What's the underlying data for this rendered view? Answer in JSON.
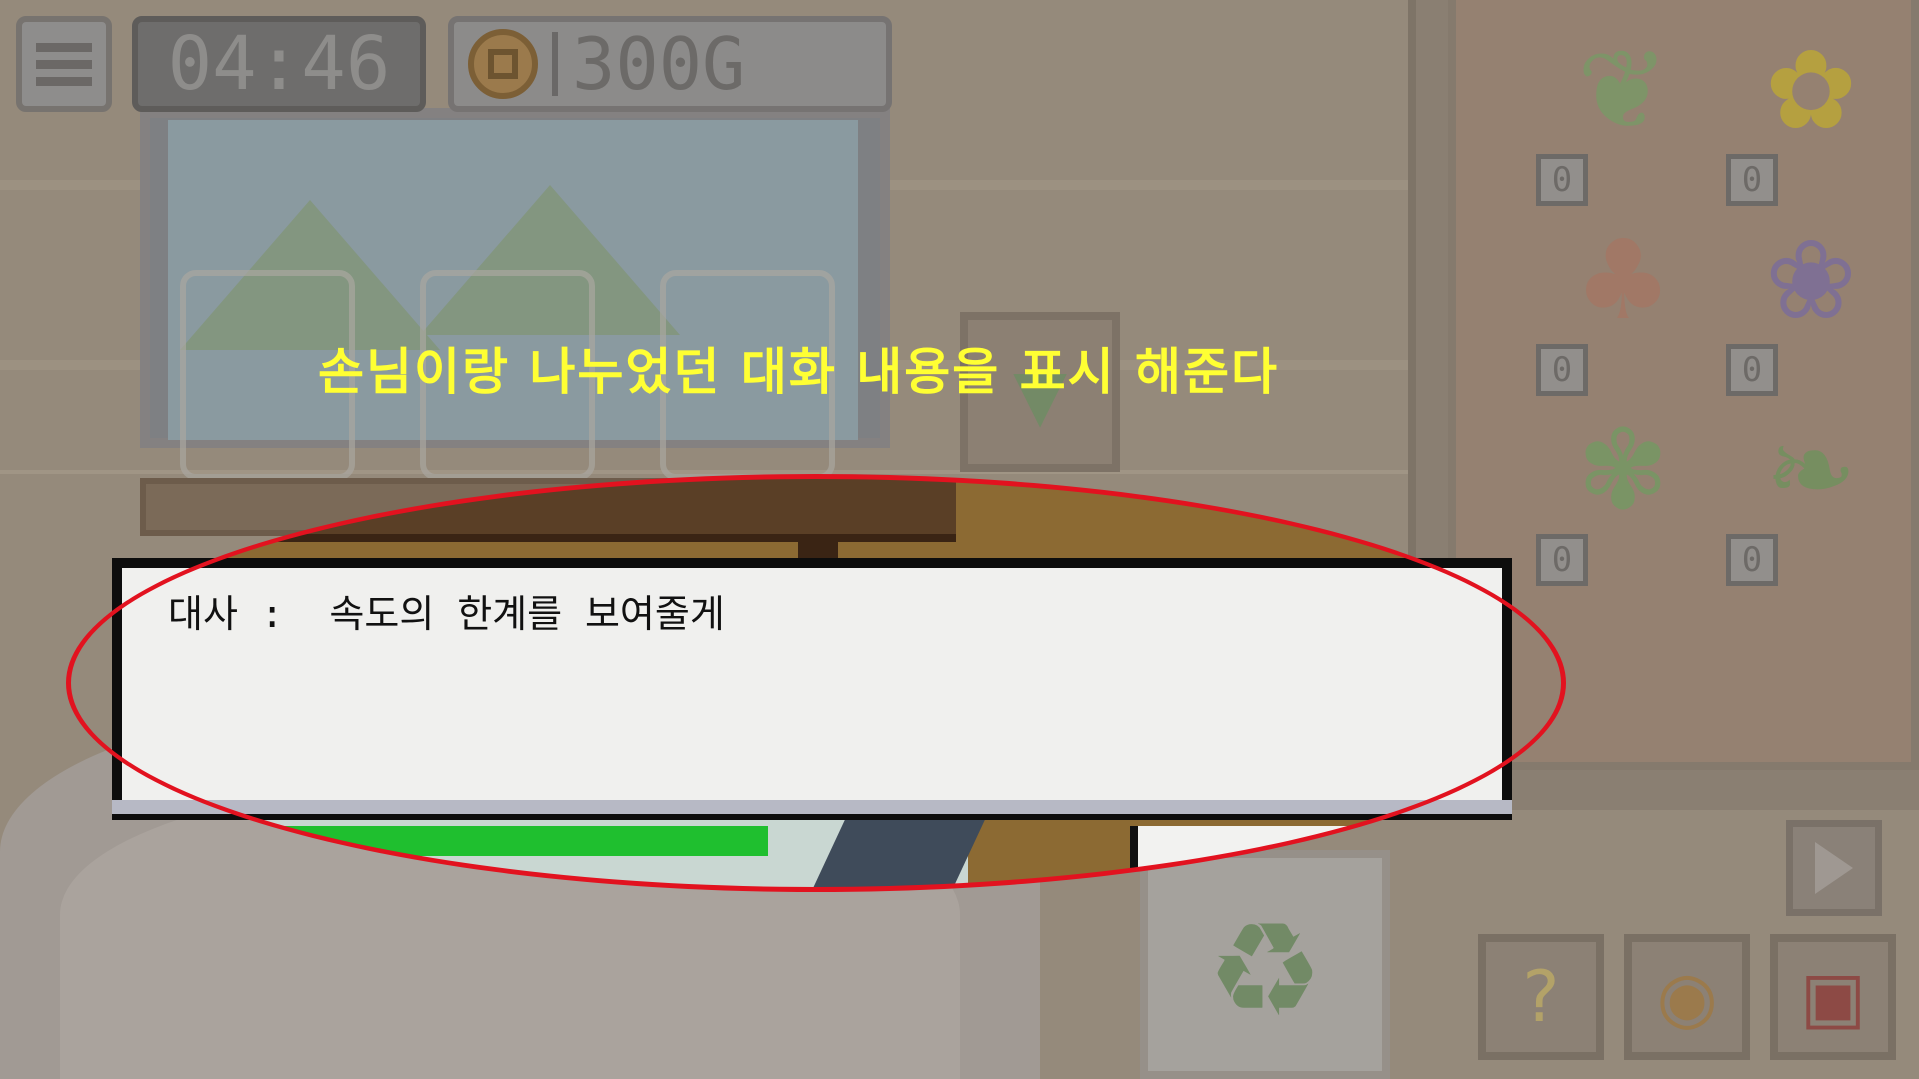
{
  "hud": {
    "timer": "04:46",
    "gold": "300G"
  },
  "tutorial": {
    "caption": "손님이랑 나누었던 대화 내용을 표시 해준다"
  },
  "dialog": {
    "text": "대사 :  속도의 한계를 보여줄게"
  },
  "inventory": {
    "items": [
      {
        "name": "herb-green",
        "count": "0",
        "glyph": "❦"
      },
      {
        "name": "flower-yellow",
        "count": "0",
        "glyph": "✿"
      },
      {
        "name": "mushroom",
        "count": "0",
        "glyph": "♣"
      },
      {
        "name": "flower-purple",
        "count": "0",
        "glyph": "❀"
      },
      {
        "name": "aloe",
        "count": "0",
        "glyph": "✾"
      },
      {
        "name": "berry-branch",
        "count": "0",
        "glyph": "❧"
      }
    ]
  },
  "buttons": {
    "hint_glyph": "?",
    "coin_glyph": "◉",
    "book_glyph": "▣",
    "recycle_glyph": "♻",
    "drop_glyph": "▼"
  },
  "colors": {
    "highlight_ring": "#e2121f",
    "caption": "#ffff33",
    "dialog_bg": "#f0f0ee"
  }
}
